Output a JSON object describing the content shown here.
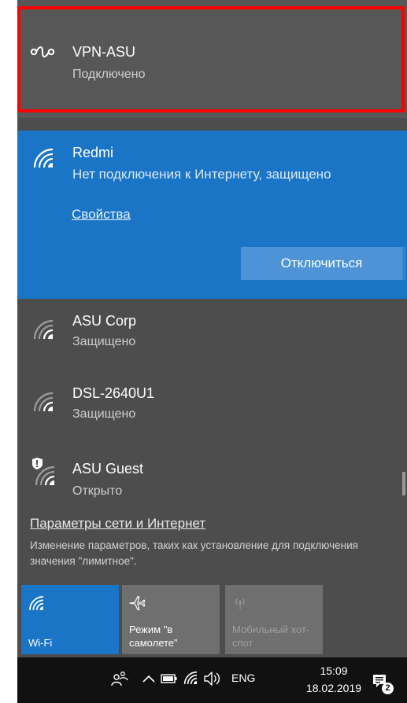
{
  "vpn": {
    "name": "VPN-ASU",
    "status": "Подключено"
  },
  "active_network": {
    "name": "Redmi",
    "status": "Нет подключения к Интернету, защищено",
    "properties_link": "Свойства",
    "disconnect_label": "Отключиться"
  },
  "networks": [
    {
      "name": "ASU Corp",
      "status": "Защищено",
      "icon": "wifi-signal-icon"
    },
    {
      "name": "DSL-2640U1",
      "status": "Защищено",
      "icon": "wifi-signal-icon"
    },
    {
      "name": "ASU Guest",
      "status": "Открыто",
      "icon": "wifi-shield-icon"
    }
  ],
  "settings": {
    "link": "Параметры сети и Интернет",
    "description": "Изменение параметров, таких как установление для подключения значения \"лимитное\"."
  },
  "quick_actions": [
    {
      "label": "Wi-Fi",
      "state": "on"
    },
    {
      "label": "Режим \"в самолете\"",
      "state": "off"
    },
    {
      "label": "Мобильный хот-спот",
      "state": "disabled"
    }
  ],
  "taskbar": {
    "language": "ENG",
    "time": "15:09",
    "date": "18.02.2019",
    "notification_count": "2"
  },
  "colors": {
    "panel": "#4d4d4d",
    "accent": "#1a75c6",
    "highlight_border": "#ff0000",
    "taskbar": "#111111"
  }
}
